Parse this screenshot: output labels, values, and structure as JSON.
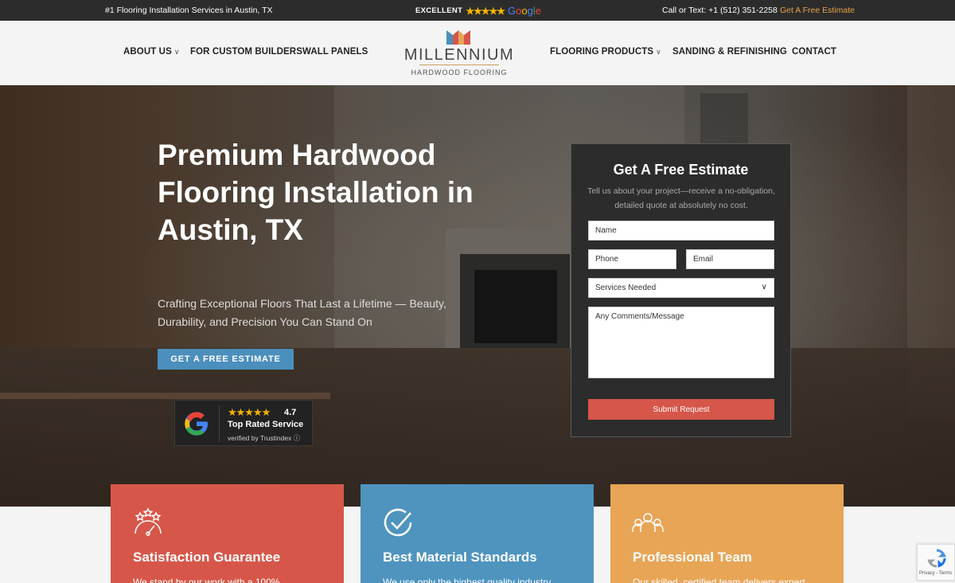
{
  "topbar": {
    "tagline": "#1 Flooring Installation Services in Austin, TX",
    "rating_label": "EXCELLENT",
    "rating_stars": 5,
    "google_word": "Google",
    "call_text": "Call or Text: +1 (512) 351-2258",
    "estimate_link": "Get A Free Estimate"
  },
  "nav": {
    "about": "ABOUT US",
    "builders": "FOR CUSTOM BUILDERS",
    "panels": "WALL PANELS",
    "products": "FLOORING PRODUCTS",
    "sanding": "SANDING & REFINISHING",
    "contact": "CONTACT"
  },
  "logo": {
    "name": "MILLENNIUM",
    "sub": "HARDWOOD FLOORING"
  },
  "hero": {
    "heading": "Premium Hardwood Flooring Installation in Austin, TX",
    "lead": "Crafting Exceptional Floors That Last a Lifetime — Beauty, Durability, and Precision You Can Stand On",
    "cta": "GET A FREE ESTIMATE"
  },
  "badge": {
    "stars": "★★★★★",
    "rating": "4.7",
    "title": "Top Rated Service",
    "verified": "verified by Trustindex ⓘ"
  },
  "form": {
    "title": "Get A Free Estimate",
    "description": "Tell us about your project—receive a no-obligation, detailed quote at absolutely no cost.",
    "name_placeholder": "Name",
    "phone_placeholder": "Phone",
    "email_placeholder": "Email",
    "services_selected": "Services Needed",
    "message_placeholder": "Any Comments/Message",
    "submit": "Submit Request"
  },
  "cards": [
    {
      "title": "Satisfaction Guarantee",
      "text": "We stand by our work with a 100%",
      "icon": "gauge-stars-icon",
      "color": "#d6574a"
    },
    {
      "title": "Best Material Standards",
      "text": "We use only the highest quality industry",
      "icon": "check-circle-icon",
      "color": "#4e94bf"
    },
    {
      "title": "Professional Team",
      "text": "Our skilled, certified team delivers expert",
      "icon": "team-icon",
      "color": "#e8a556"
    }
  ],
  "recaptcha": {
    "text": "Privacy - Terms"
  },
  "colors": {
    "accent_blue": "#4b8fbd",
    "accent_red": "#d6564a",
    "accent_orange": "#e8a556",
    "dark": "#2c2c2c"
  }
}
